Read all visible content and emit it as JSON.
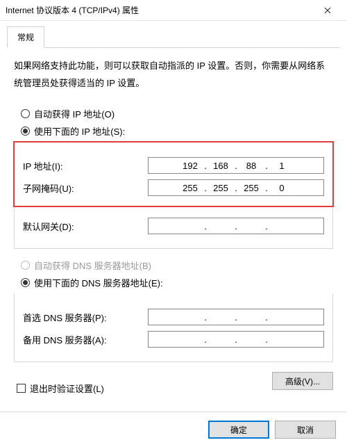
{
  "window": {
    "title": "Internet 协议版本 4 (TCP/IPv4) 属性"
  },
  "tab": {
    "general": "常规"
  },
  "description": "如果网络支持此功能，则可以获取自动指派的 IP 设置。否则，你需要从网络系统管理员处获得适当的 IP 设置。",
  "ip": {
    "radio_auto": "自动获得 IP 地址(O)",
    "radio_manual": "使用下面的 IP 地址(S):",
    "label_ip": "IP 地址(I):",
    "label_mask": "子网掩码(U):",
    "label_gateway": "默认网关(D):",
    "value_ip": {
      "o1": "192",
      "o2": "168",
      "o3": "88",
      "o4": "1"
    },
    "value_mask": {
      "o1": "255",
      "o2": "255",
      "o3": "255",
      "o4": "0"
    },
    "value_gateway": {
      "o1": "",
      "o2": "",
      "o3": "",
      "o4": ""
    }
  },
  "dns": {
    "radio_auto": "自动获得 DNS 服务器地址(B)",
    "radio_manual": "使用下面的 DNS 服务器地址(E):",
    "label_primary": "首选 DNS 服务器(P):",
    "label_secondary": "备用 DNS 服务器(A):",
    "value_primary": {
      "o1": "",
      "o2": "",
      "o3": "",
      "o4": ""
    },
    "value_secondary": {
      "o1": "",
      "o2": "",
      "o3": "",
      "o4": ""
    }
  },
  "validate_checkbox": "退出时验证设置(L)",
  "buttons": {
    "advanced": "高级(V)...",
    "ok": "确定",
    "cancel": "取消"
  }
}
